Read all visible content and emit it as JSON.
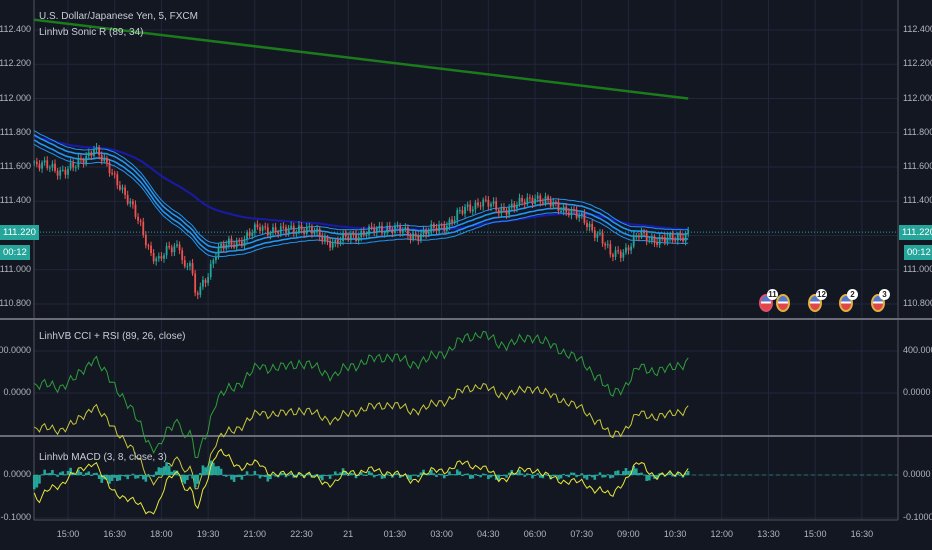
{
  "header": {
    "symbol_title": "U.S. Dollar/Japanese Yen, 5, FXCM"
  },
  "indicators": {
    "sonic": "Linhvb Sonic R (89, 34)",
    "cci_rsi": "LinhVB CCI + RSI (89, 26, close)",
    "macd": "Linhvb MACD (3, 8, close, 3)"
  },
  "price_axis": {
    "labels": [
      "112.400",
      "112.200",
      "112.000",
      "111.800",
      "111.600",
      "111.400",
      "111.000",
      "110.800"
    ],
    "current_price": "111.220",
    "countdown": "00:12"
  },
  "cci_axis": {
    "labels": [
      "400.0000",
      "0.0000"
    ]
  },
  "macd_axis": {
    "labels": [
      "0.0000",
      "-0.1000"
    ]
  },
  "time_axis": {
    "labels": [
      "15:00",
      "16:30",
      "18:00",
      "19:30",
      "21:00",
      "22:30",
      "21",
      "01:30",
      "03:00",
      "04:30",
      "06:00",
      "07:30",
      "09:00",
      "10:30",
      "12:00",
      "13:30",
      "15:00",
      "16:30"
    ]
  },
  "events": [
    {
      "count": "11",
      "ring": "#e0506a"
    },
    {
      "count": "",
      "ring": "#e0b040"
    },
    {
      "count": "12",
      "ring": "#e0b040"
    },
    {
      "count": "2",
      "ring": "#e0b040"
    },
    {
      "count": "3",
      "ring": "#e0b040"
    }
  ],
  "colors": {
    "up": "#26a69a",
    "down": "#ef5350",
    "ema89": "#1a1aa8",
    "band": "#2196f3",
    "slow_ma": "#1b7a1b",
    "cci": "#2e9e3a",
    "rsi": "#c8c83a",
    "macd": "#e8e83a",
    "hist": "#26a69a",
    "bg": "#131722"
  },
  "chart_data": {
    "type": "candlestick",
    "symbol": "USDJPY",
    "timeframe": "5",
    "ylim": [
      110.75,
      112.45
    ],
    "close_path": [
      [
        "13:55",
        111.62
      ],
      [
        "14:45",
        111.58
      ],
      [
        "15:15",
        111.6
      ],
      [
        "15:40",
        111.68
      ],
      [
        "15:50",
        111.72
      ],
      [
        "16:10",
        111.62
      ],
      [
        "16:40",
        111.5
      ],
      [
        "17:00",
        111.38
      ],
      [
        "17:20",
        111.25
      ],
      [
        "17:40",
        111.1
      ],
      [
        "17:55",
        111.05
      ],
      [
        "18:15",
        111.12
      ],
      [
        "18:35",
        111.15
      ],
      [
        "18:45",
        111.0
      ],
      [
        "18:55",
        111.05
      ],
      [
        "19:05",
        110.84
      ],
      [
        "19:25",
        110.95
      ],
      [
        "19:45",
        111.1
      ],
      [
        "20:10",
        111.15
      ],
      [
        "20:40",
        111.18
      ],
      [
        "21:10",
        111.25
      ],
      [
        "21:50",
        111.22
      ],
      [
        "22:25",
        111.25
      ],
      [
        "23:05",
        111.2
      ],
      [
        "23:35",
        111.15
      ],
      [
        "00:05",
        111.2
      ],
      [
        "00:40",
        111.22
      ],
      [
        "01:20",
        111.25
      ],
      [
        "02:00",
        111.2
      ],
      [
        "02:35",
        111.22
      ],
      [
        "03:15",
        111.28
      ],
      [
        "03:45",
        111.35
      ],
      [
        "04:15",
        111.4
      ],
      [
        "04:50",
        111.35
      ],
      [
        "05:30",
        111.38
      ],
      [
        "06:00",
        111.43
      ],
      [
        "06:30",
        111.38
      ],
      [
        "07:05",
        111.35
      ],
      [
        "07:35",
        111.28
      ],
      [
        "08:05",
        111.2
      ],
      [
        "08:25",
        111.08
      ],
      [
        "08:55",
        111.12
      ],
      [
        "09:20",
        111.2
      ],
      [
        "09:50",
        111.18
      ],
      [
        "10:20",
        111.17
      ],
      [
        "10:55",
        111.22
      ]
    ],
    "slow_ma": [
      [
        "13:55",
        112.46
      ],
      [
        "10:55",
        112.0
      ]
    ]
  }
}
